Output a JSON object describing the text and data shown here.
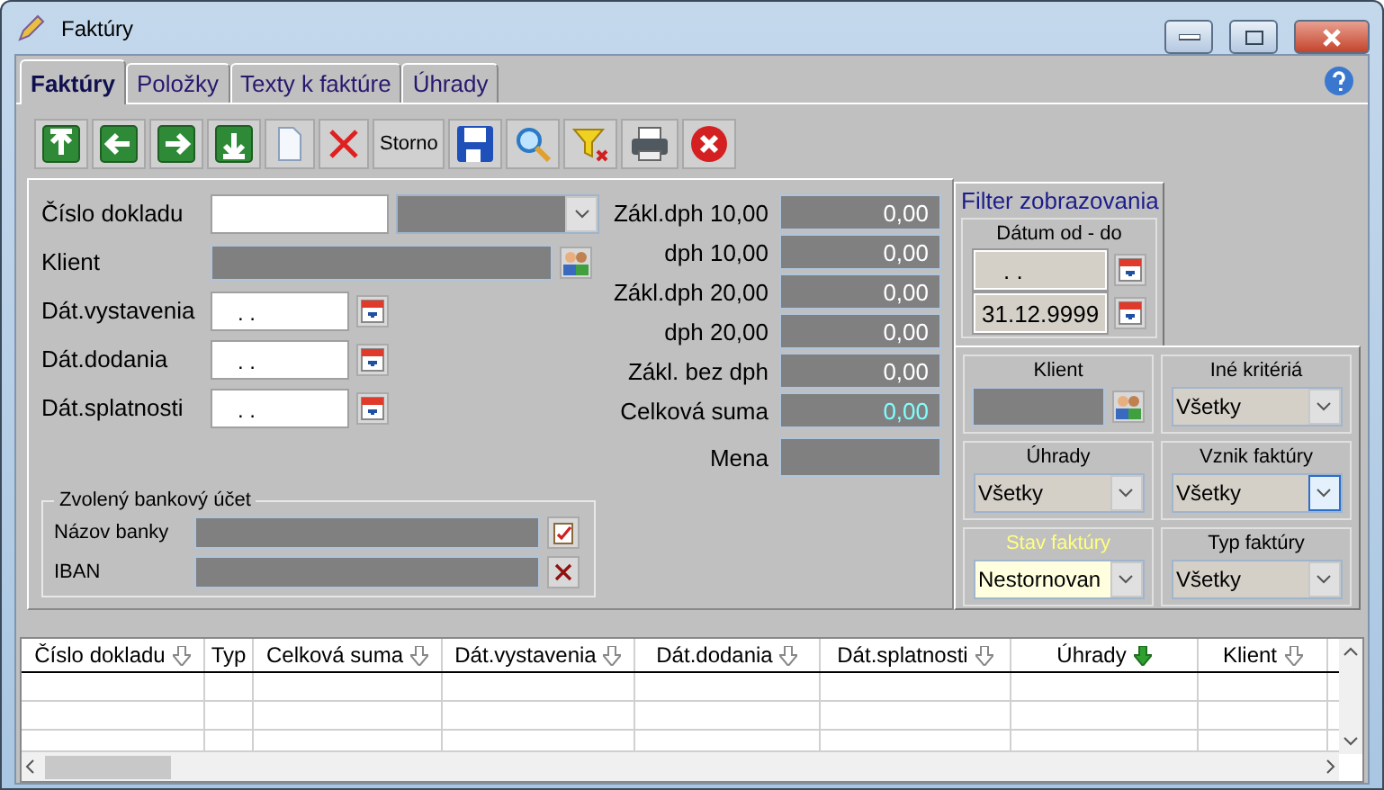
{
  "window": {
    "title": "Faktúry"
  },
  "tabs": [
    {
      "label": "Faktúry",
      "selected": true
    },
    {
      "label": "Položky",
      "selected": false
    },
    {
      "label": "Texty k faktúre",
      "selected": false
    },
    {
      "label": "Úhrady",
      "selected": false
    }
  ],
  "toolbar": [
    {
      "kind": "first"
    },
    {
      "kind": "prev"
    },
    {
      "kind": "next"
    },
    {
      "kind": "last"
    },
    {
      "kind": "new"
    },
    {
      "kind": "delete"
    },
    {
      "kind": "text",
      "label": "Storno"
    },
    {
      "kind": "save"
    },
    {
      "kind": "search"
    },
    {
      "kind": "clear-filter"
    },
    {
      "kind": "print"
    },
    {
      "kind": "close"
    }
  ],
  "form": {
    "doc_number": {
      "label": "Číslo dokladu"
    },
    "client": {
      "label": "Klient"
    },
    "dates": [
      {
        "label": "Dát.vystavenia",
        "value": ". ."
      },
      {
        "label": "Dát.dodania",
        "value": ". ."
      },
      {
        "label": "Dát.splatnosti",
        "value": ". ."
      }
    ],
    "totals": [
      {
        "label": "Zákl.dph 10,00",
        "value": "0,00",
        "highlighted": false
      },
      {
        "label": "dph 10,00",
        "value": "0,00",
        "highlighted": false
      },
      {
        "label": "Zákl.dph 20,00",
        "value": "0,00",
        "highlighted": false
      },
      {
        "label": "dph 20,00",
        "value": "0,00",
        "highlighted": false
      },
      {
        "label": "Zákl. bez dph",
        "value": "0,00",
        "highlighted": false
      },
      {
        "label": "Celková suma",
        "value": "0,00",
        "highlighted": true
      },
      {
        "label": "Mena"
      }
    ],
    "bank": {
      "title": "Zvolený bankový účet",
      "fields": [
        {
          "label": "Názov banky",
          "kind": "pick"
        },
        {
          "label": "IBAN",
          "kind": "clear"
        }
      ]
    }
  },
  "filter": {
    "title": "Filter zobrazovania",
    "date_label": "Dátum od - do",
    "date_from": ". .",
    "date_to": "31.12.9999",
    "client_label": "Klient",
    "criteria": [
      {
        "label": "Iné kritériá",
        "value": "Všetky",
        "focused": false,
        "highlighted": false
      },
      {
        "label": "Úhrady",
        "value": "Všetky",
        "focused": false,
        "highlighted": false
      },
      {
        "label": "Vznik faktúry",
        "value": "Všetky",
        "focused": true,
        "highlighted": false
      },
      {
        "label": "Stav faktúry",
        "value": "Nestornovan",
        "focused": false,
        "highlighted": true
      },
      {
        "label": "Typ faktúry",
        "value": "Všetky",
        "focused": false,
        "highlighted": false
      }
    ]
  },
  "table": {
    "columns": [
      {
        "label": "Číslo dokladu",
        "sorted": false
      },
      {
        "label": "Typ"
      },
      {
        "label": "Celková suma",
        "sorted": false
      },
      {
        "label": "Dát.vystavenia",
        "sorted": false
      },
      {
        "label": "Dát.dodania",
        "sorted": false
      },
      {
        "label": "Dát.splatnosti",
        "sorted": false
      },
      {
        "label": "Úhrady",
        "sorted": true
      },
      {
        "label": "Klient",
        "sorted": false
      }
    ]
  }
}
